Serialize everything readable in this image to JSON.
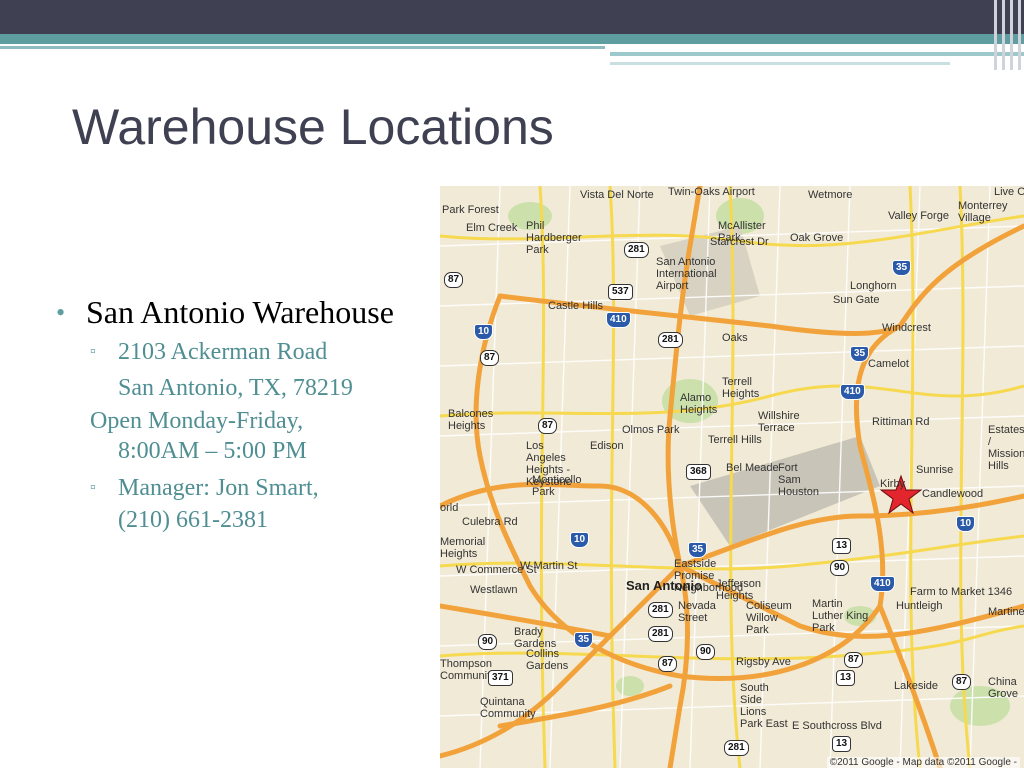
{
  "slide": {
    "title": "Warehouse Locations",
    "bullet": "San Antonio Warehouse",
    "address_line1": "2103 Ackerman Road",
    "address_line2": "San Antonio, TX, 78219",
    "hours_line1": "Open Monday-Friday,",
    "hours_line2": "8:00AM – 5:00 PM",
    "manager_line1": "Manager:  Jon Smart,",
    "manager_line2": "(210) 661-2381"
  },
  "map": {
    "credit": "©2011 Google - Map data ©2011 Google -",
    "marker_icon": "star-icon",
    "labels": {
      "vista_del_norte": "Vista Del Norte",
      "twin_oaks_airport": "Twin-Oaks Airport",
      "wetmore": "Wetmore",
      "park_forest": "Park Forest",
      "phil_hardberger_park": "Phil Hardberger Park",
      "mcallister_park": "McAllister Park",
      "elm_creek": "Elm Creek",
      "starcrest_dr": "Starcrest Dr",
      "oak_grove": "Oak Grove",
      "valley_forge": "Valley Forge",
      "monterrey_village": "Monterrey Village",
      "live_oak": "Live Oa",
      "san_antonio_intl_airport": "San Antonio International Airport",
      "longhorn": "Longhorn",
      "sun_gate": "Sun Gate",
      "castle_hills": "Castle Hills",
      "windcrest": "Windcrest",
      "oaks": "Oaks",
      "camelot": "Camelot",
      "terrell_heights": "Terrell Heights",
      "alamo_heights": "Alamo Heights",
      "willshire_terrace": "Willshire Terrace",
      "balcones_heights": "Balcones Heights",
      "olmos_park": "Olmos Park",
      "terrell_hills": "Terrell Hills",
      "edison": "Edison",
      "los_angeles_heights_keystone": "Los Angeles Heights - Keystone",
      "rittiman_rd": "Rittiman Rd",
      "estates_mission_hills": "Estates / Mission Hills",
      "bel_meade": "Bel Meade",
      "fort_sam_houston": "Fort Sam Houston",
      "sunrise": "Sunrise",
      "monticello_park": "Monticello Park",
      "candlewood": "Candlewood",
      "kirby": "Kirby",
      "culebra_rd": "Culebra Rd",
      "memorial_heights": "Memorial Heights",
      "w_martin_st": "W Martin St",
      "w_commerce_st": "W Commerce St",
      "eastside_promise": "Eastside Promise Neighborhood",
      "san_antonio": "San Antonio",
      "jefferson_heights": "Jefferson Heights",
      "westlawn": "Westlawn",
      "nevada_street": "Nevada Street",
      "coliseum_willow_park": "Coliseum Willow Park",
      "martin_luther_king_park": "Martin Luther King Park",
      "huntleigh": "Huntleigh",
      "martinez": "Martinez",
      "brady_gardens": "Brady Gardens",
      "collins_gardens": "Collins Gardens",
      "thompson_community": "Thompson Community",
      "rigsby_ave": "Rigsby Ave",
      "lakeside": "Lakeside",
      "china_grove": "China Grove",
      "quintana_community": "Quintana Community",
      "south_side_lions_park_east": "South Side Lions Park East",
      "e_southcross_blvd": "E Southcross Blvd",
      "farm_to_market_1346": "Farm to Market 1346",
      "oldis": "orld"
    },
    "shields": {
      "i10_nw": "10",
      "i410_n": "410",
      "i35_ne": "35",
      "i35_center": "35",
      "i410_e": "410",
      "i10_e": "10",
      "i410_se": "410",
      "i35_south": "35",
      "i10_center": "10",
      "i35_sa": "35",
      "us281_n": "281",
      "us281_mid": "281",
      "us281_s": "281",
      "us281_ss": "281",
      "us281_bottom": "281",
      "us87_nw": "87",
      "us87_w": "87",
      "us87_mid": "87",
      "us87_e": "87",
      "us87_se": "87",
      "us87_far": "87",
      "us90_w": "90",
      "us90_c": "90",
      "us90_e": "90",
      "s537": "537",
      "s368": "368",
      "s13": "13",
      "s13b": "13",
      "s13c": "13",
      "s371": "371"
    }
  }
}
